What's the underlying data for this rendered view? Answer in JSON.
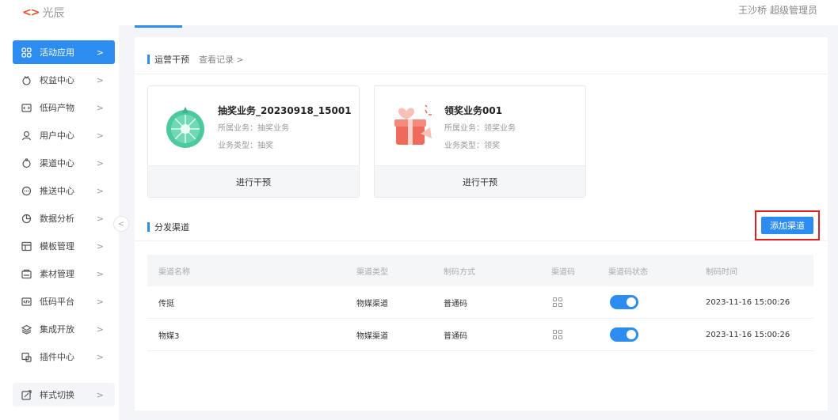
{
  "header": {
    "logo_mark": "<>",
    "logo_text": "光辰",
    "user_text": "王沙桥 超级管理员"
  },
  "sidebar": {
    "items": [
      {
        "label": "活动应用",
        "icon": "grid-icon",
        "active": true
      },
      {
        "label": "权益中心",
        "icon": "gift-icon"
      },
      {
        "label": "低码产物",
        "icon": "code-icon"
      },
      {
        "label": "用户中心",
        "icon": "user-icon"
      },
      {
        "label": "渠道中心",
        "icon": "channel-icon"
      },
      {
        "label": "推送中心",
        "icon": "message-icon"
      },
      {
        "label": "数据分析",
        "icon": "pie-chart-icon"
      },
      {
        "label": "模板管理",
        "icon": "template-icon"
      },
      {
        "label": "素材管理",
        "icon": "material-icon"
      },
      {
        "label": "低码平台",
        "icon": "code-platform-icon"
      },
      {
        "label": "集成开放",
        "icon": "layers-icon"
      },
      {
        "label": "插件中心",
        "icon": "plugin-icon"
      },
      {
        "label": "样式切换",
        "icon": "style-switch-icon"
      }
    ],
    "arrow": ">",
    "collapse": "<"
  },
  "ops": {
    "title": "运营干预",
    "link": "查看记录 >"
  },
  "cards": [
    {
      "name": "抽奖业务_20230918_15001",
      "biz": "所属业务：抽奖业务",
      "type": "业务类型：抽奖",
      "action": "进行干预",
      "accent": "#4cc9a0"
    },
    {
      "name": "领奖业务001",
      "biz": "所属业务：领奖业务",
      "type": "业务类型：领奖",
      "action": "进行干预",
      "accent": "#ef6a5a"
    }
  ],
  "channels": {
    "title": "分发渠道",
    "add_button": "添加渠道",
    "columns": [
      "渠道名称",
      "渠道类型",
      "制码方式",
      "渠道码",
      "渠道码状态",
      "制码时间"
    ],
    "rows": [
      {
        "name": "传挺",
        "type": "物媒渠道",
        "method": "普通码",
        "enabled": true,
        "time": "2023-11-16 15:00:26"
      },
      {
        "name": "物媒3",
        "type": "物媒渠道",
        "method": "普通码",
        "enabled": true,
        "time": "2023-11-16 15:00:26"
      }
    ]
  },
  "colors": {
    "primary": "#2d8cf0",
    "highlight": "#e02020"
  }
}
